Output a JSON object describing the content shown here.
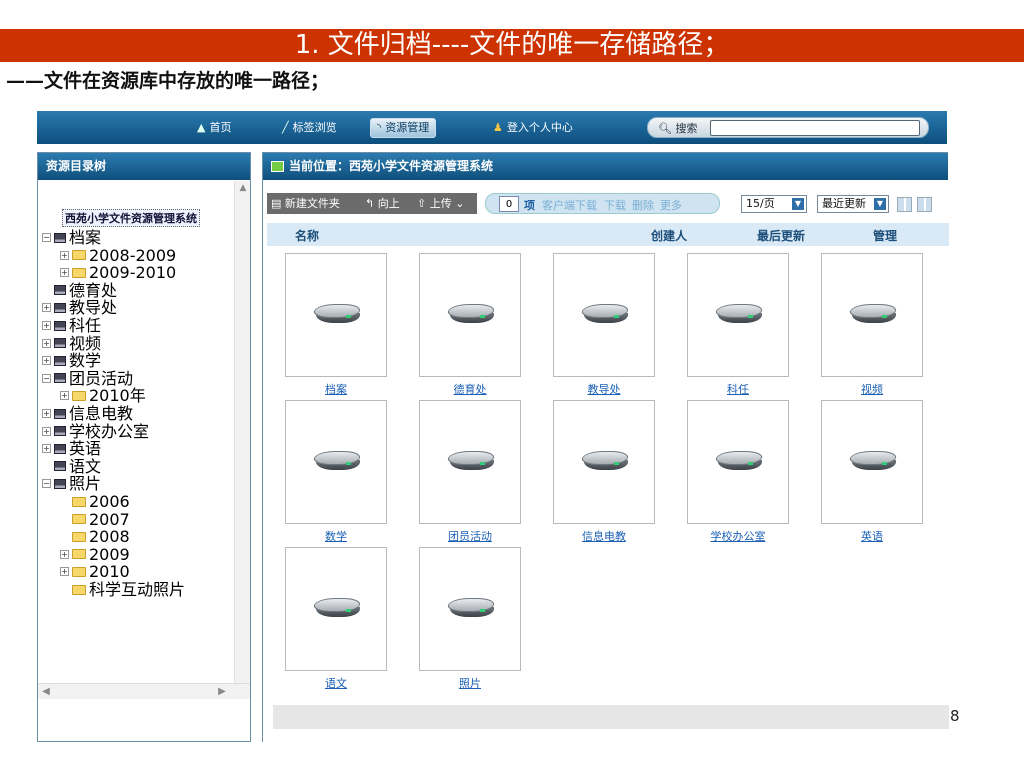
{
  "slide": {
    "title": "1. 文件归档----文件的唯一存储路径；",
    "subtitle": "——文件在资源库中存放的唯一路径；",
    "page_number": "8"
  },
  "topnav": {
    "items": [
      {
        "label": "首页",
        "icon": "home-icon"
      },
      {
        "label": "标签浏览",
        "icon": "pen-icon"
      },
      {
        "label": "资源管理",
        "icon": "rss-icon",
        "active": true
      },
      {
        "label": "登入个人中心",
        "icon": "users-icon"
      }
    ],
    "search_label": "搜索",
    "search_value": ""
  },
  "left_panel": {
    "title": "资源目录树",
    "root": "西苑小学文件资源管理系统",
    "tree": [
      {
        "label": "档案",
        "type": "drive",
        "pm": "-",
        "level": 0
      },
      {
        "label": "2008-2009",
        "type": "folder",
        "pm": "+",
        "level": 1
      },
      {
        "label": "2009-2010",
        "type": "folder",
        "pm": "+",
        "level": 1
      },
      {
        "label": "德育处",
        "type": "drive",
        "pm": "",
        "level": 0
      },
      {
        "label": "教导处",
        "type": "drive",
        "pm": "+",
        "level": 0
      },
      {
        "label": "科任",
        "type": "drive",
        "pm": "+",
        "level": 0
      },
      {
        "label": "视频",
        "type": "drive",
        "pm": "+",
        "level": 0
      },
      {
        "label": "数学",
        "type": "drive",
        "pm": "+",
        "level": 0
      },
      {
        "label": "团员活动",
        "type": "drive",
        "pm": "-",
        "level": 0
      },
      {
        "label": "2010年",
        "type": "folder",
        "pm": "+",
        "level": 1
      },
      {
        "label": "信息电教",
        "type": "drive",
        "pm": "+",
        "level": 0
      },
      {
        "label": "学校办公室",
        "type": "drive",
        "pm": "+",
        "level": 0
      },
      {
        "label": "英语",
        "type": "drive",
        "pm": "+",
        "level": 0
      },
      {
        "label": "语文",
        "type": "drive",
        "pm": "",
        "level": 0
      },
      {
        "label": "照片",
        "type": "drive",
        "pm": "-",
        "level": 0
      },
      {
        "label": "2006",
        "type": "folder",
        "pm": "",
        "level": 1
      },
      {
        "label": "2007",
        "type": "folder",
        "pm": "",
        "level": 1
      },
      {
        "label": "2008",
        "type": "folder",
        "pm": "",
        "level": 1
      },
      {
        "label": "2009",
        "type": "folder",
        "pm": "+",
        "level": 1
      },
      {
        "label": "2010",
        "type": "folder",
        "pm": "+",
        "level": 1
      },
      {
        "label": "科学互动照片",
        "type": "folder",
        "pm": "",
        "level": 1
      }
    ]
  },
  "right_panel": {
    "location": "当前位置：西苑小学文件资源管理系统",
    "toolbar": {
      "new_folder": "新建文件夹",
      "up": "向上",
      "upload": "上传",
      "count": "0",
      "count_unit": "项",
      "client_download": "客户端下载",
      "download": "下载",
      "delete": "删除",
      "more": "更多",
      "per_page": "15/页",
      "sort": "最近更新"
    },
    "columns": {
      "name": "名称",
      "creator": "创建人",
      "updated": "最后更新",
      "manage": "管理"
    },
    "items": [
      "档案",
      "德育处",
      "教导处",
      "科任",
      "视频",
      "数学",
      "团员活动",
      "信息电教",
      "学校办公室",
      "英语",
      "语文",
      "照片"
    ]
  }
}
